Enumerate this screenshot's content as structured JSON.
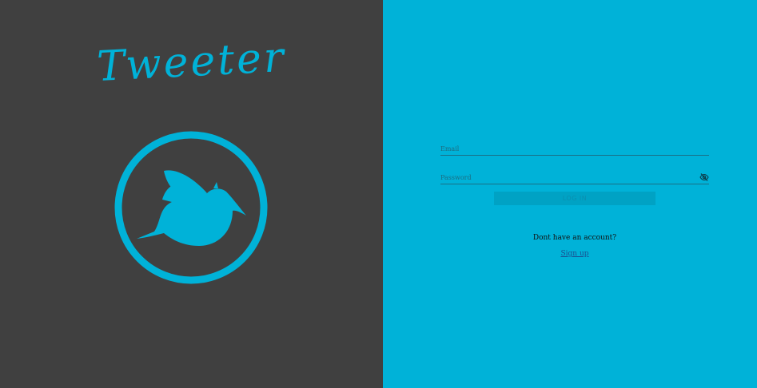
{
  "brand": {
    "title": "Tweeter",
    "accent_color": "#00b2d8",
    "logo_icon": "bird-icon"
  },
  "login_form": {
    "email_placeholder": "Email",
    "password_placeholder": "Password",
    "toggle_icon": "eye-off-icon",
    "login_label": "LOG IN"
  },
  "signup": {
    "prompt": "Dont have an account?",
    "link_label": "Sign up"
  },
  "colors": {
    "left_background": "#404040",
    "right_background": "#00b2d8"
  }
}
